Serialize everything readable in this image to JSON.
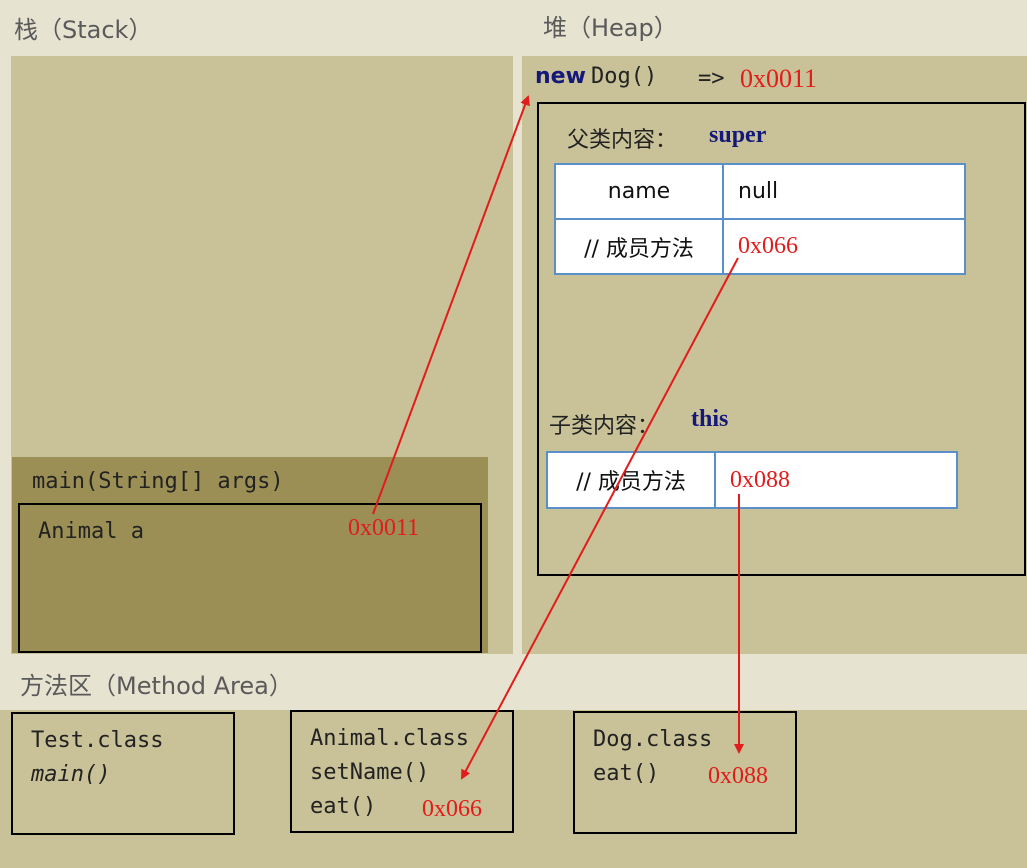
{
  "stack": {
    "title": "栈（Stack）"
  },
  "heap": {
    "title": "堆（Heap）",
    "new_keyword": "new",
    "constructor_call": "Dog()",
    "arrow_text": "=>",
    "object_address": "0x0011",
    "super_label": "父类内容：",
    "super_keyword": "super",
    "super_table": {
      "rows": [
        {
          "label": "name",
          "value": "null"
        },
        {
          "label": "// 成员方法",
          "value": "0x066"
        }
      ]
    },
    "sub_label": "子类内容：",
    "sub_keyword": "this",
    "sub_table": {
      "rows": [
        {
          "label": "// 成员方法",
          "value": "0x088"
        }
      ]
    }
  },
  "frame": {
    "header": "main(String[] args)",
    "var_name": "Animal a",
    "var_value": "0x0011"
  },
  "method_area": {
    "title": "方法区（Method Area）",
    "classes": [
      {
        "name": "Test.class",
        "methods": [
          "main()"
        ],
        "address": ""
      },
      {
        "name": "Animal.class",
        "methods": [
          "setName()",
          "eat()"
        ],
        "address": "0x066"
      },
      {
        "name": "Dog.class",
        "methods": [
          "eat()"
        ],
        "address": "0x088"
      }
    ]
  },
  "colors": {
    "arrow": "#e21b1b",
    "panel": "#c9c197",
    "frame": "#9b8f55",
    "table_border": "#5b8fc9",
    "keyword": "#14187a"
  }
}
